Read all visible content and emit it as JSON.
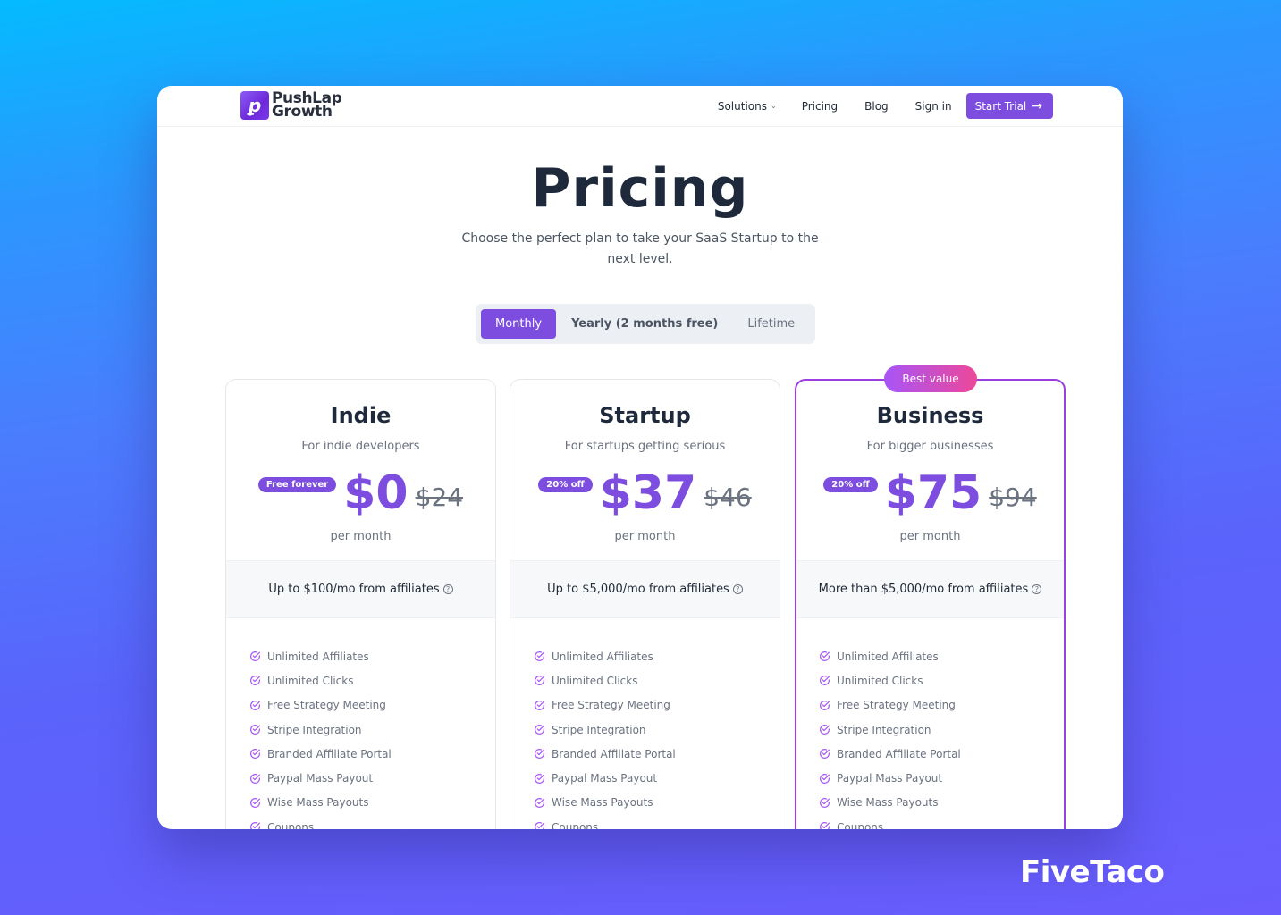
{
  "nav": {
    "logo_line1": "PushLap",
    "logo_line2": "Growth",
    "logo_glyph": "ꝑ",
    "links": [
      {
        "label": "Solutions",
        "has_dropdown": true
      },
      {
        "label": "Pricing"
      },
      {
        "label": "Blog"
      },
      {
        "label": "Sign in"
      }
    ],
    "cta_label": "Start Trial",
    "cta_icon": "arrow-right-icon"
  },
  "hero": {
    "title": "Pricing",
    "subtitle": "Choose the perfect plan to take your SaaS Startup to the next level."
  },
  "billing_toggle": {
    "options": [
      "Monthly",
      "Yearly (2 months free)",
      "Lifetime"
    ],
    "selected": "Monthly"
  },
  "plans": [
    {
      "name": "Indie",
      "description": "For indie developers",
      "badge": "Free forever",
      "price": "$0",
      "old_price": "$24",
      "period": "per month",
      "limit": "Up to $100/mo from affiliates",
      "features": [
        "Unlimited Affiliates",
        "Unlimited Clicks",
        "Free Strategy Meeting",
        "Stripe Integration",
        "Branded Affiliate Portal",
        "Paypal Mass Payout",
        "Wise Mass Payouts",
        "Coupons"
      ]
    },
    {
      "name": "Startup",
      "description": "For startups getting serious",
      "badge": "20% off",
      "price": "$37",
      "old_price": "$46",
      "period": "per month",
      "limit": "Up to $5,000/mo from affiliates",
      "features": [
        "Unlimited Affiliates",
        "Unlimited Clicks",
        "Free Strategy Meeting",
        "Stripe Integration",
        "Branded Affiliate Portal",
        "Paypal Mass Payout",
        "Wise Mass Payouts",
        "Coupons"
      ]
    },
    {
      "name": "Business",
      "description": "For bigger businesses",
      "ribbon": "Best value",
      "badge": "20% off",
      "price": "$75",
      "old_price": "$94",
      "period": "per month",
      "limit": "More than $5,000/mo from affiliates",
      "features": [
        "Unlimited Affiliates",
        "Unlimited Clicks",
        "Free Strategy Meeting",
        "Stripe Integration",
        "Branded Affiliate Portal",
        "Paypal Mass Payout",
        "Wise Mass Payouts",
        "Coupons"
      ]
    }
  ],
  "colors": {
    "accent": "#7c4ddf",
    "highlight_border": "#9c3fe0",
    "ribbon_gradient": [
      "#a855f7",
      "#ec4899"
    ]
  },
  "watermark": "FiveTaco"
}
